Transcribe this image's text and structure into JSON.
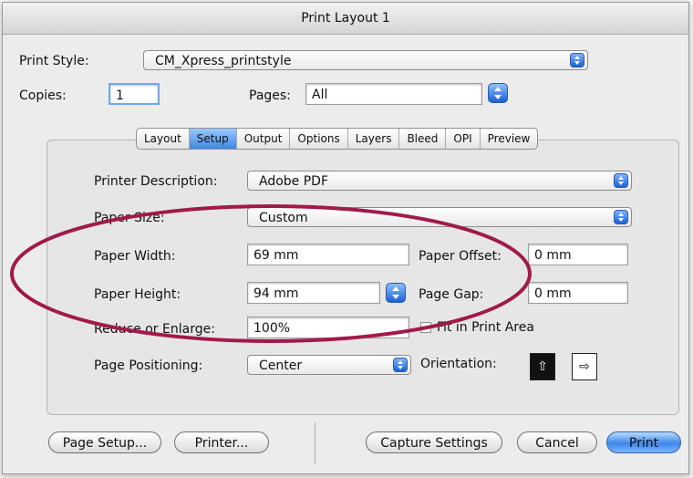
{
  "title": "Print Layout 1",
  "print_style": {
    "label": "Print Style:",
    "value": "CM_Xpress_printstyle"
  },
  "copies": {
    "label": "Copies:",
    "value": "1"
  },
  "pages": {
    "label": "Pages:",
    "value": "All"
  },
  "tabs": [
    {
      "label": "Layout",
      "active": false
    },
    {
      "label": "Setup",
      "active": true
    },
    {
      "label": "Output",
      "active": false
    },
    {
      "label": "Options",
      "active": false
    },
    {
      "label": "Layers",
      "active": false
    },
    {
      "label": "Bleed",
      "active": false
    },
    {
      "label": "OPI",
      "active": false
    },
    {
      "label": "Preview",
      "active": false
    }
  ],
  "setup": {
    "printer_description": {
      "label": "Printer Description:",
      "value": "Adobe PDF"
    },
    "paper_size": {
      "label": "Paper Size:",
      "value": "Custom"
    },
    "paper_width": {
      "label": "Paper Width:",
      "value": "69 mm"
    },
    "paper_offset": {
      "label": "Paper Offset:",
      "value": "0 mm"
    },
    "paper_height": {
      "label": "Paper Height:",
      "value": "94 mm"
    },
    "page_gap": {
      "label": "Page Gap:",
      "value": "0 mm"
    },
    "reduce_enlarge": {
      "label": "Reduce or Enlarge:",
      "value": "100%"
    },
    "fit_print_area": {
      "label": "Fit in Print Area",
      "checked": false
    },
    "page_positioning": {
      "label": "Page Positioning:",
      "value": "Center"
    },
    "orientation": {
      "label": "Orientation:",
      "selected": "portrait"
    }
  },
  "buttons": {
    "page_setup": "Page Setup...",
    "printer": "Printer...",
    "capture_settings": "Capture Settings",
    "cancel": "Cancel",
    "print": "Print"
  },
  "colors": {
    "annotation_ellipse": "#a01a4a",
    "accent_blue": "#3f86e4"
  }
}
